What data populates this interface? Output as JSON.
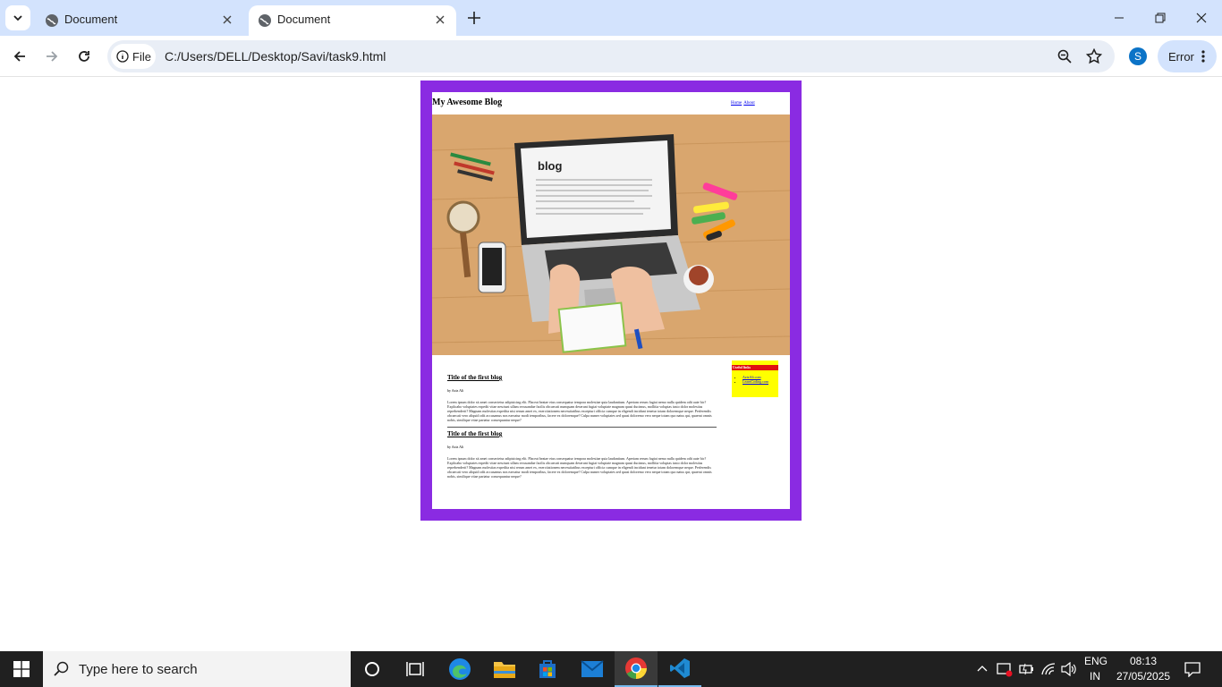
{
  "browser": {
    "tabs": [
      {
        "title": "Document",
        "active": false
      },
      {
        "title": "Document",
        "active": true
      }
    ],
    "omnibox": {
      "scheme_label": "File",
      "url": "C:/Users/DELL/Desktop/Savi/task9.html"
    },
    "profile_initial": "S",
    "error_label": "Error"
  },
  "page": {
    "blog_title": "My Awesome Blog",
    "nav": [
      "Home",
      "About"
    ],
    "hero_text": "blog",
    "posts": [
      {
        "title": "Title of the first blog",
        "byline": "by Aziz Ali",
        "body": "Lorem ipsum dolor sit amet consectetur adipisicing elit. Placeat beatae eius consequatur tempora molestiae quia laudantium. Aperiam rerum fugiat nemo nulla quidem odit aute hic? Explicabo voluptates expedit vitae nesciunt ullam recusandae facilis obcaecati numquam deserunt fugiat voluptate magnam quasi ducimus, mollitia voluptas iusto dolor molestias reprehenderit? Magnam molestias expedita nisi rerum amet ex, exercitationem necessitatibus excepturi officia cumque in eligendi incidunt tenetur totam doloremque neque. Perferendis obcaecati vero aliquid odit accusamus nos eaecatur modi temporibus, facere ex doloremque? Culpa numer voluptates sed quasi doloremo vero neque totam quo natus qui, quaerat omnis nobis, similique vitae pariatur consequuntur neque?"
      },
      {
        "title": "Title of the first blog",
        "byline": "by Aziz Ali",
        "body": "Lorem ipsum dolor sit amet consectetur adipisicing elit. Placeat beatae eius consequatur tempora molestiae quia laudantium. Aperiam rerum fugiat nemo nulla quidem odit aute hic? Explicabo voluptates expedit vitae nesciunt ullam recusandae facilis obcaecati numquam deserunt fugiat voluptate magnam quasi ducimus, mollitia voluptas iusto dolor molestias reprehenderit? Magnam molestias expedita nisi rerum amet ex, exercitationem necessitatibus excepturi officia cumque in eligendi incidunt tenetur totam doloremque neque. Perferendis obcaecati vero aliquid odit accusamus nos eaecatur modi temporibus, facere ex doloremque? Culpa numer voluptates sed quasi doloremo vero neque totam quo natus qui, quaerat omnis nobis, similique vitae pariatur consequuntur neque?"
      }
    ],
    "sidebar": {
      "heading": "Useful links",
      "links": [
        "AzizAli.com",
        "LearnCoding.com"
      ]
    },
    "colors": {
      "border": "#8a2be2",
      "sidebar_bg": "#ffff00",
      "sidebar_heading": "#e01010"
    }
  },
  "taskbar": {
    "search_placeholder": "Type here to search",
    "lang_top": "ENG",
    "lang_bottom": "IN",
    "time": "08:13",
    "date": "27/05/2025"
  }
}
